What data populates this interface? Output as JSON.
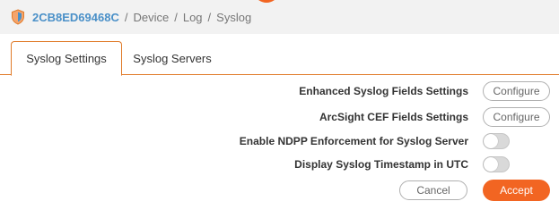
{
  "breadcrumb": {
    "device_id": "2CB8ED69468C",
    "separator": "/",
    "path": [
      "Device",
      "Log",
      "Syslog"
    ]
  },
  "tabs": [
    {
      "label": "Syslog Settings",
      "active": true
    },
    {
      "label": "Syslog Servers",
      "active": false
    }
  ],
  "settings": {
    "enhanced_fields": {
      "label": "Enhanced Syslog Fields Settings",
      "button": "Configure"
    },
    "arcsight_fields": {
      "label": "ArcSight CEF Fields Settings",
      "button": "Configure"
    },
    "ndpp": {
      "label": "Enable NDPP Enforcement for Syslog Server",
      "enabled": false
    },
    "utc": {
      "label": "Display Syslog Timestamp in UTC",
      "enabled": false
    }
  },
  "actions": {
    "cancel": "Cancel",
    "accept": "Accept"
  },
  "colors": {
    "accent": "#f26522",
    "tab_border": "#e07b2a",
    "link_blue": "#4a90c8"
  },
  "icons": {
    "breadcrumb": "shield-icon"
  }
}
